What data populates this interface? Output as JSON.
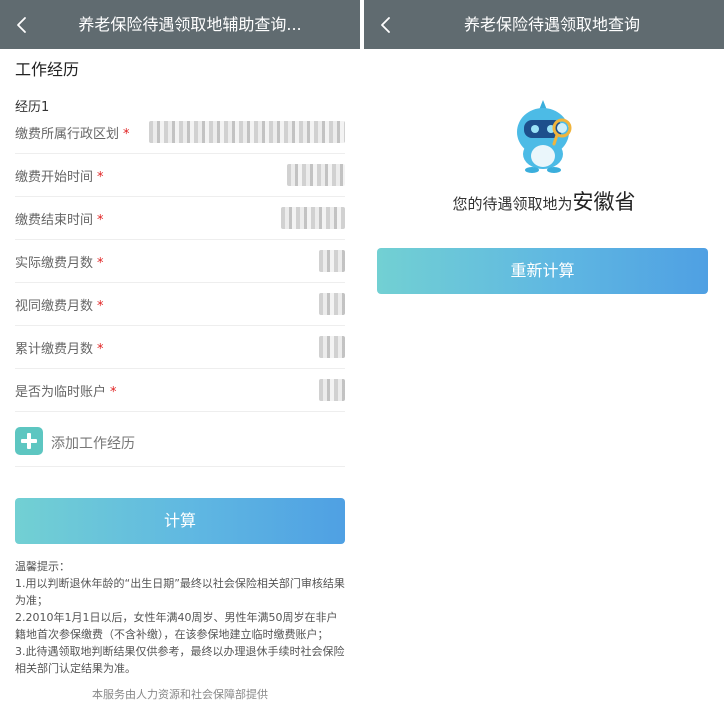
{
  "left": {
    "header": {
      "title": "养老保险待遇领取地辅助查询..."
    },
    "section_title": "工作经历",
    "group_label": "经历1",
    "fields": [
      {
        "label": "缴费所属行政区划",
        "required": "*"
      },
      {
        "label": "缴费开始时间",
        "required": "*"
      },
      {
        "label": "缴费结束时间",
        "required": "*"
      },
      {
        "label": "实际缴费月数",
        "required": "*"
      },
      {
        "label": "视同缴费月数",
        "required": "*"
      },
      {
        "label": "累计缴费月数",
        "required": "*"
      },
      {
        "label": "是否为临时账户",
        "required": "*"
      }
    ],
    "add_label": "添加工作经历",
    "calc_label": "计算",
    "tips": [
      "温馨提示：",
      "1.用以判断退休年龄的“出生日期”最终以社会保险相关部门审核结果为准；",
      "2.2010年1月1日以后，女性年满40周岁、男性年满50周岁在非户籍地首次参保缴费（不含补缴），在该参保地建立临时缴费账户；",
      "3.此待遇领取地判断结果仅供参考，最终以办理退休手续时社会保险相关部门认定结果为准。"
    ],
    "footer": "本服务由人力资源和社会保障部提供"
  },
  "right": {
    "header": {
      "title": "养老保险待遇领取地查询"
    },
    "result_prefix": "您的待遇领取地为",
    "result_province": "安徽省",
    "recalc_label": "重新计算"
  },
  "colors": {
    "header_bg": "#606b70",
    "button_gradient_start": "#72d0d3",
    "button_gradient_end": "#4fa0e3",
    "required": "#e02020",
    "add_icon": "#5dc6c1"
  },
  "icons": {
    "back": "chevron-left-icon",
    "add": "plus-square-icon",
    "mascot": "mascot-illustration"
  }
}
